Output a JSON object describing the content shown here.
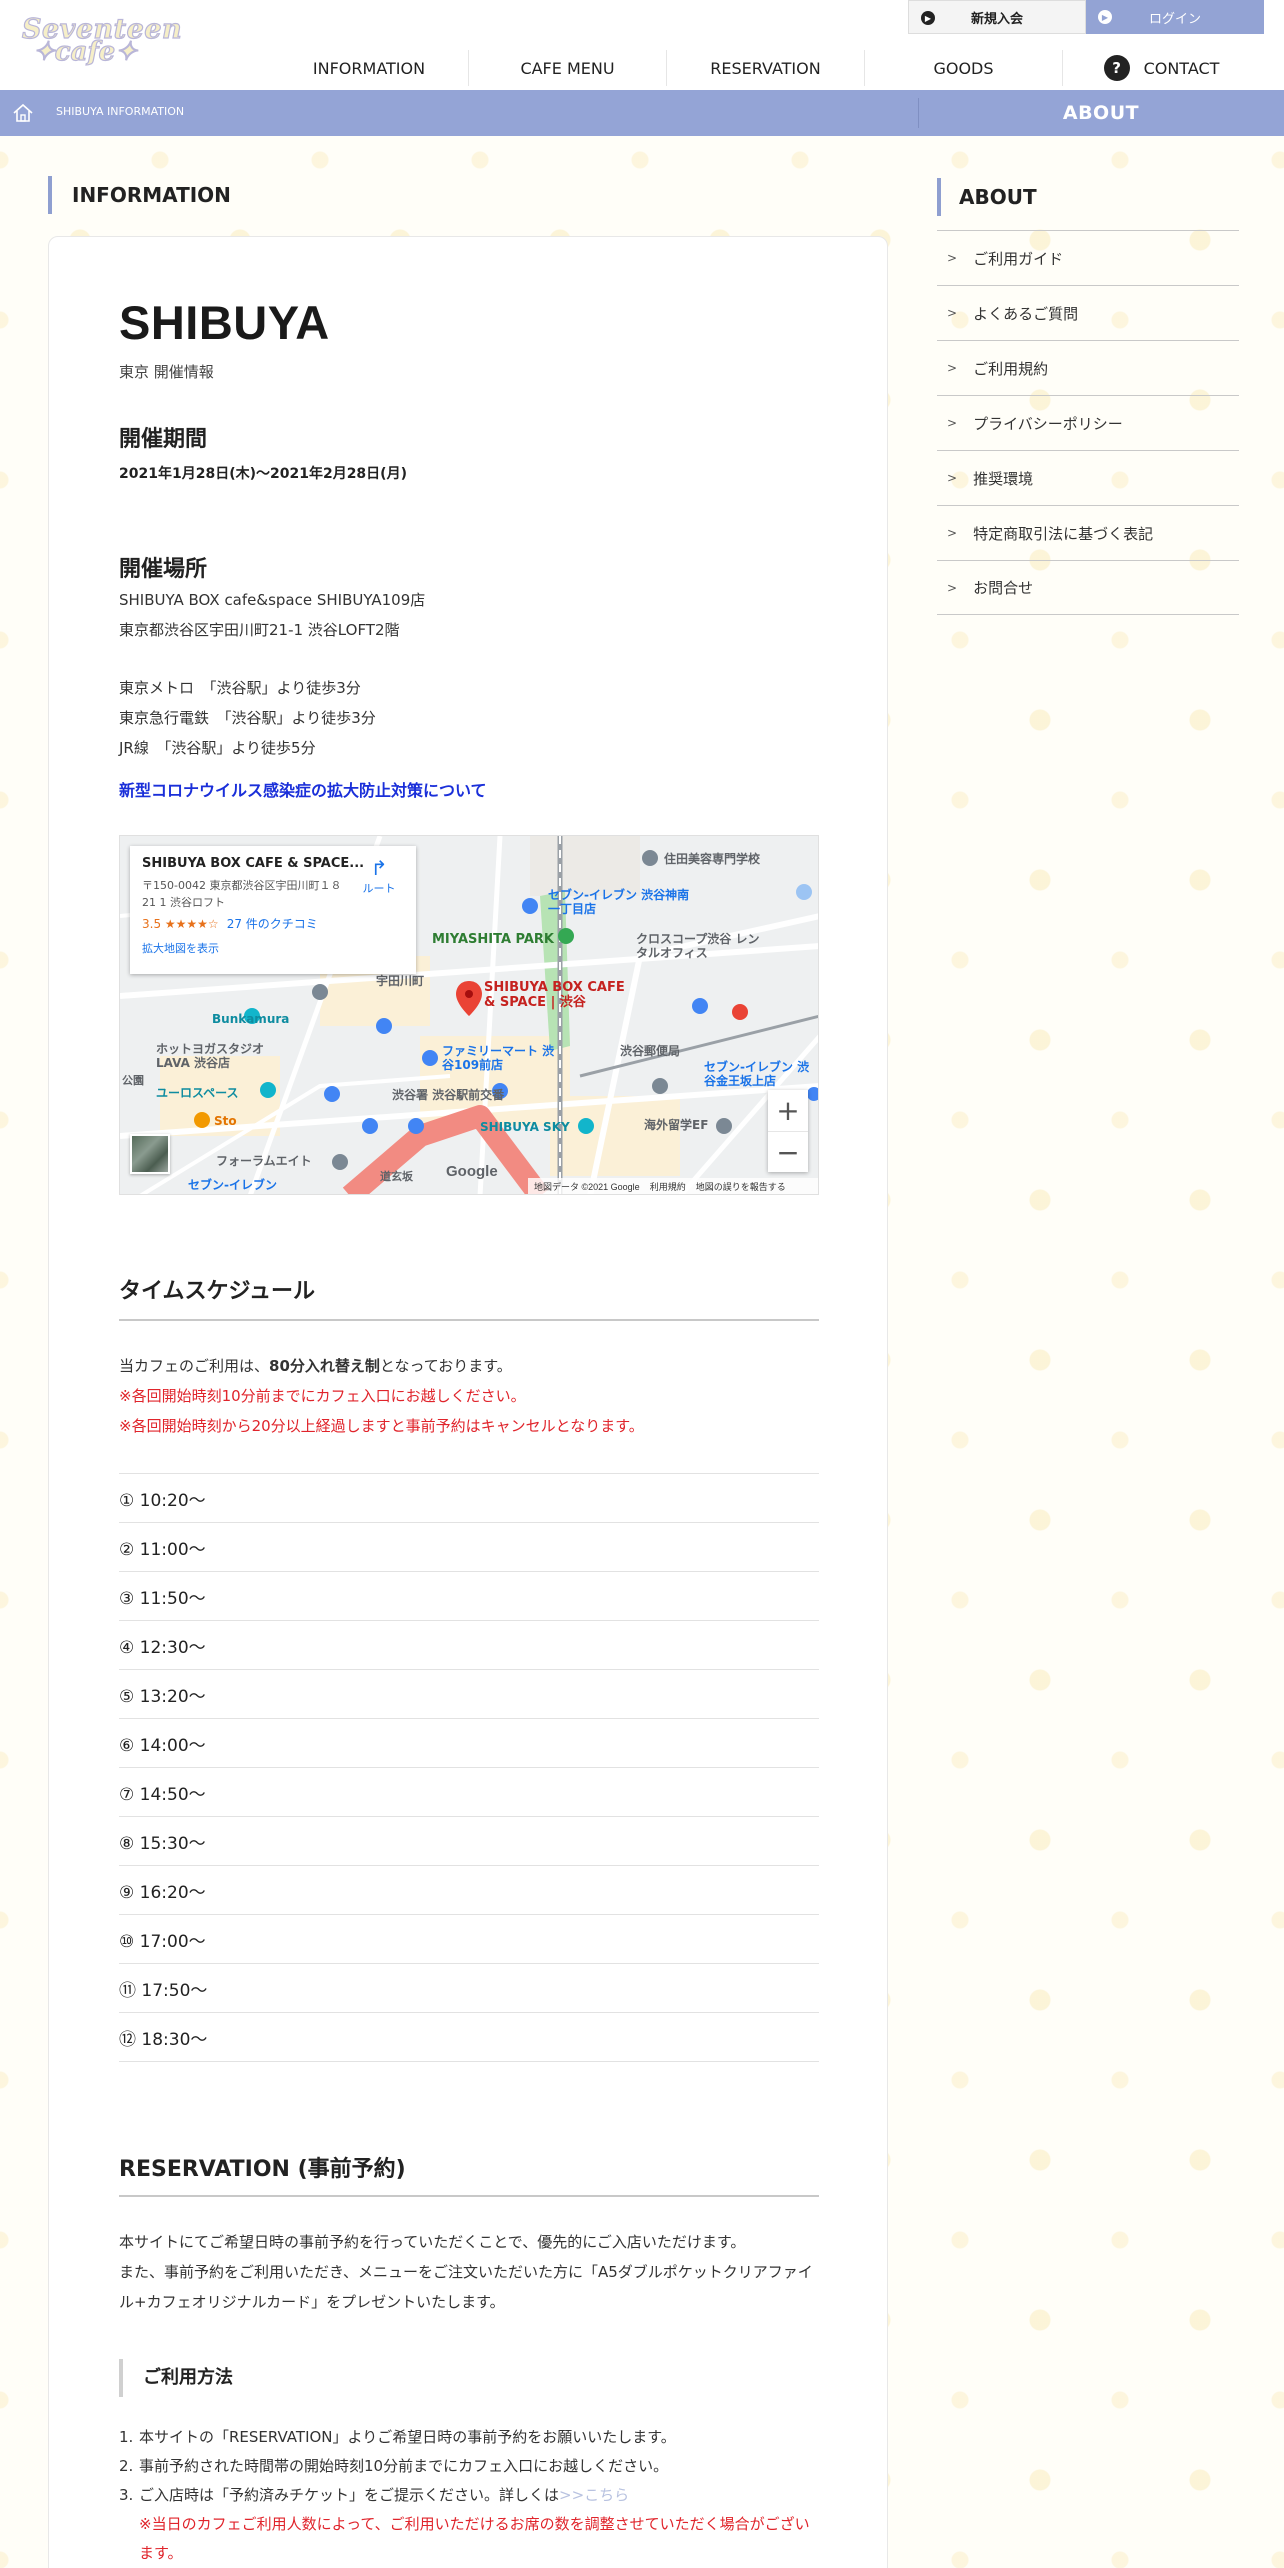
{
  "header": {
    "logo_top": "Seventeen",
    "logo_bottom": "cafe",
    "register_label": "新規入会",
    "login_label": "ログイン",
    "nav": [
      "INFORMATION",
      "CAFE MENU",
      "RESERVATION",
      "GOODS",
      "CONTACT"
    ]
  },
  "breadcrumb": {
    "text": "SHIBUYA INFORMATION"
  },
  "about_bar": "ABOUT",
  "main": {
    "heading": "INFORMATION",
    "title": "SHIBUYA",
    "subtitle": "東京 開催情報",
    "period_heading": "開催期間",
    "period": "2021年1月28日(木)～2021年2月28日(月)",
    "venue_heading": "開催場所",
    "venue_name": "SHIBUYA BOX cafe&space SHIBUYA109店",
    "venue_address": "東京都渋谷区宇田川町21-1 渋谷LOFT2階",
    "access": [
      "東京メトロ　「渋谷駅」より徒歩3分",
      "東京急行電鉄　「渋谷駅」より徒歩3分",
      "JR線　「渋谷駅」より徒歩5分"
    ],
    "covid_link": "新型コロナウイルス感染症の拡大防止対策について"
  },
  "map": {
    "place_title": "SHIBUYA BOX CAFE & SPACE...",
    "address": "〒150-0042 東京都渋谷区宇田川町１８ 21 1 渋谷ロフト",
    "rating": "3.5 ★★★★☆",
    "reviews": "27 件のクチコミ",
    "enlarge": "拡大地図を表示",
    "route": "ルート",
    "pin_label": "SHIBUYA BOX CAFE & SPACE | 渋谷",
    "labels": {
      "miyashita": "MIYASHITA PARK",
      "seven1": "セブン-イレブン 渋谷神南一丁目店",
      "sumida": "住田美容専門学校",
      "crosscope": "クロスコープ渋谷 レンタルオフィス",
      "udagawa": "宇田川町",
      "bunkamura": "Bunkamura",
      "hotyoga": "ホットヨガスタジオ LAVA 渋谷店",
      "family": "ファミリーマート 渋谷109前店",
      "euro": "ユーロスペース",
      "sto": "Sto",
      "shibuya_sky": "SHIBUYA SKY",
      "kaigai": "海外留学EF",
      "post": "渋谷郵便局",
      "seven2": "セブン-イレブン 渋谷金王坂上店",
      "forum": "フォーラムエイト",
      "seven3": "セブン-イレブン",
      "shibuyaeki": "渋谷署 渋谷駅前交番",
      "kouen": "公園",
      "douei": "道玄坂"
    },
    "zoom_in": "+",
    "zoom_out": "−",
    "google": "Google",
    "footer_data": "地図データ ©2021 Google",
    "footer_terms": "利用規約",
    "footer_report": "地図の誤りを報告する"
  },
  "schedule": {
    "title": "タイムスケジュール",
    "intro_pre": "当カフェのご利用は、",
    "intro_bold": "80分入れ替え制",
    "intro_post": "となっております。",
    "note1": "※各回開始時刻10分前までにカフェ入口にお越しください。",
    "note2": "※各回開始時刻から20分以上経過しますと事前予約はキャンセルとなります。",
    "slots": [
      "① 10:20～",
      "② 11:00～",
      "③ 11:50～",
      "④ 12:30～",
      "⑤ 13:20～",
      "⑥ 14:00～",
      "⑦ 14:50～",
      "⑧ 15:30～",
      "⑨ 16:20～",
      "⑩ 17:00～",
      "⑪ 17:50～",
      "⑫ 18:30～"
    ]
  },
  "reservation": {
    "title": "RESERVATION (事前予約)",
    "p1": "本サイトにてご希望日時の事前予約を行っていただくことで、優先的にご入店いただけます。",
    "p2": "また、事前予約をご利用いただき、メニューをご注文いただいた方に「A5ダブルポケットクリアファイル+カフェオリジナルカード」をプレゼントいたします。",
    "howto_heading": "ご利用方法",
    "steps": [
      "本サイトの「RESERVATION」よりご希望日時の事前予約をお願いいたします。",
      "事前予約された時間帯の開始時刻10分前までにカフェ入口にお越しください。",
      "ご入店時は「予約済みチケット」をご提示ください。詳しくは"
    ],
    "step3_link": ">>こちら",
    "step3_note": "※当日のカフェご利用人数によって、ご利用いただけるお席の数を調整させていただく場合がございます。"
  },
  "sidebar": {
    "heading": "ABOUT",
    "items": [
      "ご利用ガイド",
      "よくあるご質問",
      "ご利用規約",
      "プライバシーポリシー",
      "推奨環境",
      "特定商取引法に基づく表記",
      "お問合せ"
    ]
  }
}
